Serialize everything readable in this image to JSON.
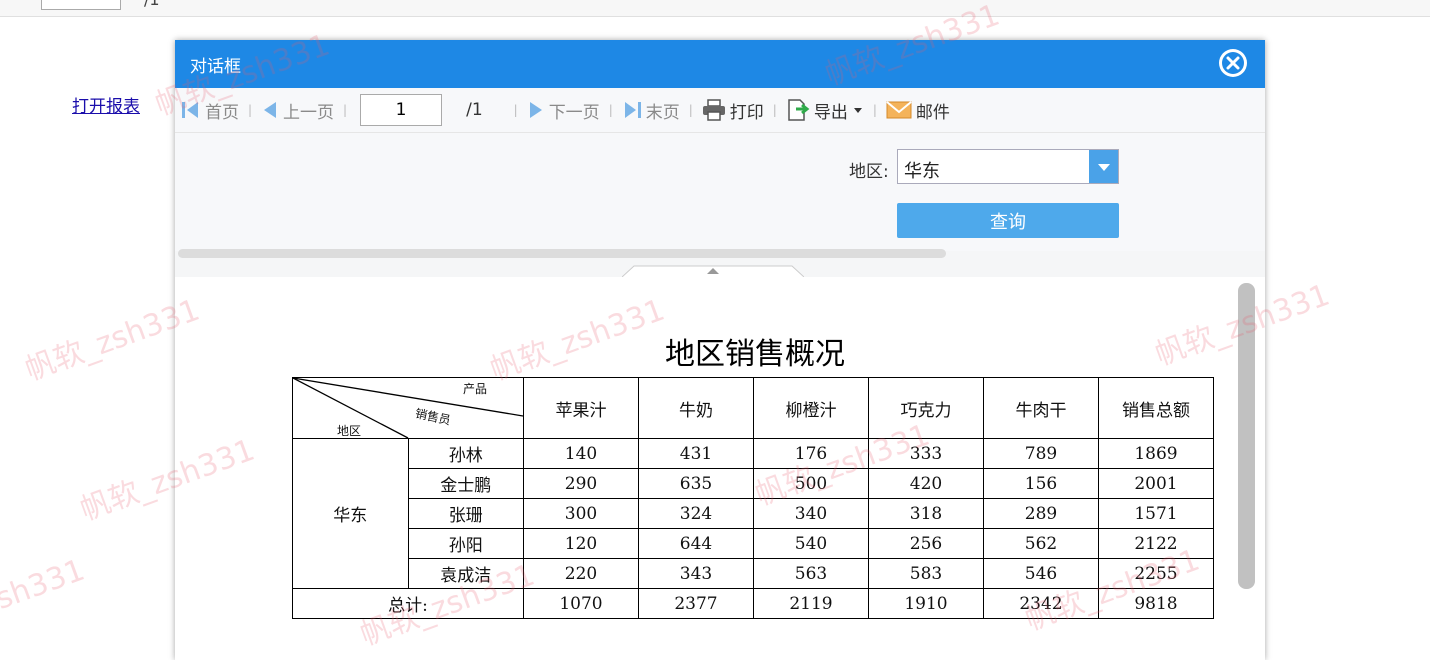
{
  "background": {
    "page_total": "/1",
    "link_text": "打开报表"
  },
  "watermarks": [
    "帆软_zsh331",
    "帆软_zsh331",
    "帆软_zsh331",
    "帆软_zsh331",
    "帆软_zsh331",
    "帆软_zsh331",
    "帆软_zsh331",
    "帆软_zsh331",
    "帆软_zsh331",
    "帆软_zsh331"
  ],
  "dialog": {
    "title": "对话框",
    "toolbar": {
      "first": "首页",
      "prev": "上一页",
      "page_value": "1",
      "page_total": "/1",
      "next": "下一页",
      "last": "末页",
      "print": "打印",
      "export": "导出",
      "email": "邮件"
    },
    "params": {
      "region_label": "地区:",
      "region_value": "华东",
      "query_button": "查询"
    }
  },
  "report": {
    "title": "地区销售概况",
    "header_diag": {
      "product": "产品",
      "salesperson": "销售员",
      "region": "地区"
    },
    "columns": [
      "苹果汁",
      "牛奶",
      "柳橙汁",
      "巧克力",
      "牛肉干",
      "销售总额"
    ],
    "region": "华东",
    "rows": [
      {
        "name": "孙林",
        "values": [
          "140",
          "431",
          "176",
          "333",
          "789",
          "1869"
        ]
      },
      {
        "name": "金士鹏",
        "values": [
          "290",
          "635",
          "500",
          "420",
          "156",
          "2001"
        ]
      },
      {
        "name": "张珊",
        "values": [
          "300",
          "324",
          "340",
          "318",
          "289",
          "1571"
        ]
      },
      {
        "name": "孙阳",
        "values": [
          "120",
          "644",
          "540",
          "256",
          "562",
          "2122"
        ]
      },
      {
        "name": "袁成洁",
        "values": [
          "220",
          "343",
          "563",
          "583",
          "546",
          "2255"
        ]
      }
    ],
    "total_label": "总计:",
    "totals": [
      "1070",
      "2377",
      "2119",
      "1910",
      "2342",
      "9818"
    ]
  },
  "colors": {
    "title_bar": "#1e88e5",
    "query_button": "#4ea9eb",
    "watermark": "#e65a6e"
  }
}
